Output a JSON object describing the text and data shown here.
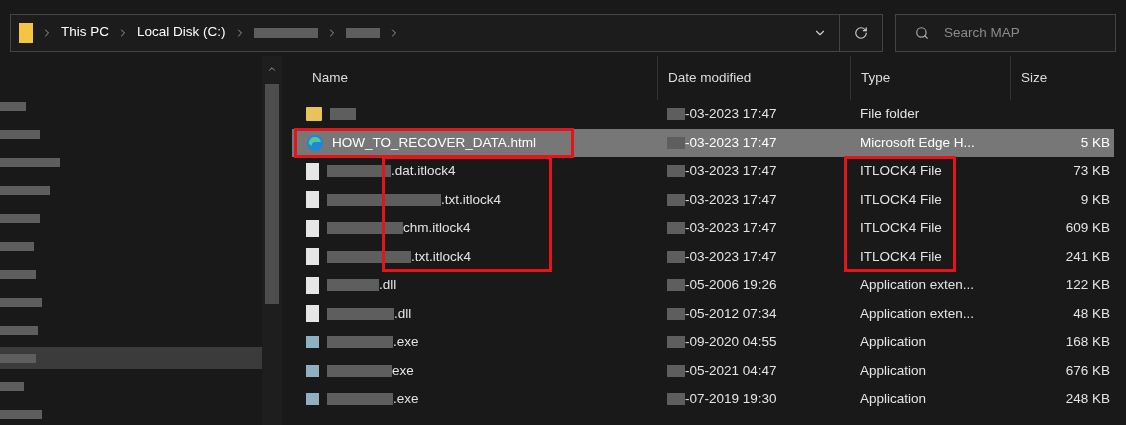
{
  "address_bar": {
    "crumbs": [
      {
        "label": "This PC",
        "redacted": false
      },
      {
        "label": "Local Disk (C:)",
        "redacted": false
      },
      {
        "redacted": true
      },
      {
        "redacted": true
      }
    ]
  },
  "search": {
    "placeholder": "Search MAP"
  },
  "sidebar": {
    "items": [
      {
        "selected": false
      },
      {
        "selected": false
      },
      {
        "selected": false
      },
      {
        "selected": false
      },
      {
        "selected": false
      },
      {
        "selected": false
      },
      {
        "selected": false
      },
      {
        "selected": false
      },
      {
        "selected": false
      },
      {
        "selected": true
      },
      {
        "selected": false
      },
      {
        "selected": false
      }
    ]
  },
  "table": {
    "columns": [
      "Name",
      "Date modified",
      "Type",
      "Size"
    ],
    "rows": [
      {
        "kind": "folder",
        "date": "-03-2023 17:47",
        "type": "File folder",
        "selected": false,
        "name_boxed": false,
        "name_marked": false,
        "type_marked": false
      },
      {
        "kind": "edge",
        "name": "HOW_TO_RECOVER_DATA.html",
        "date": "-03-2023 17:47",
        "type": "Microsoft Edge H...",
        "size": "5 KB",
        "selected": true,
        "name_boxed": true,
        "name_marked": false,
        "type_marked": false
      },
      {
        "kind": "file",
        "name": ".dat.itlock4",
        "date": "-03-2023 17:47",
        "type": "ITLOCK4 File",
        "size": "73 KB",
        "selected": false,
        "name_boxed": false,
        "name_marked": true,
        "type_marked": true
      },
      {
        "kind": "file",
        "name": ".txt.itlock4",
        "date": "-03-2023 17:47",
        "type": "ITLOCK4 File",
        "size": "9 KB",
        "selected": false,
        "name_boxed": false,
        "name_marked": true,
        "type_marked": true
      },
      {
        "kind": "file",
        "name": "chm.itlock4",
        "date": "-03-2023 17:47",
        "type": "ITLOCK4 File",
        "size": "609 KB",
        "selected": false,
        "name_boxed": false,
        "name_marked": true,
        "type_marked": true
      },
      {
        "kind": "file",
        "name": ".txt.itlock4",
        "date": "-03-2023 17:47",
        "type": "ITLOCK4 File",
        "size": "241 KB",
        "selected": false,
        "name_boxed": false,
        "name_marked": true,
        "type_marked": true
      },
      {
        "kind": "dll",
        "name": ".dll",
        "date": "-05-2006 19:26",
        "type": "Application exten...",
        "size": "122 KB",
        "selected": false,
        "name_boxed": false,
        "name_marked": false,
        "type_marked": false
      },
      {
        "kind": "dll",
        "name": ".dll",
        "date": "-05-2012 07:34",
        "type": "Application exten...",
        "size": "48 KB",
        "selected": false,
        "name_boxed": false,
        "name_marked": false,
        "type_marked": false
      },
      {
        "kind": "exe",
        "name": ".exe",
        "date": "-09-2020 04:55",
        "type": "Application",
        "size": "168 KB",
        "selected": false,
        "name_boxed": false,
        "name_marked": false,
        "type_marked": false
      },
      {
        "kind": "exe",
        "name": "exe",
        "date": "-05-2021 04:47",
        "type": "Application",
        "size": "676 KB",
        "selected": false,
        "name_boxed": false,
        "name_marked": false,
        "type_marked": false
      },
      {
        "kind": "exe",
        "name": ".exe",
        "date": "-07-2019 19:30",
        "type": "Application",
        "size": "248 KB",
        "selected": false,
        "name_boxed": false,
        "name_marked": false,
        "type_marked": false
      }
    ]
  }
}
